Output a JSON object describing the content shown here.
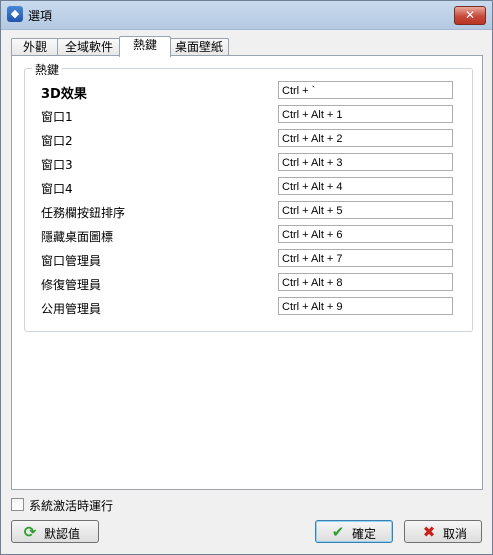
{
  "window": {
    "title": "選項",
    "close_glyph": "✕",
    "app_icon_glyph": "◆"
  },
  "tabs": [
    {
      "label": "外觀",
      "active": false
    },
    {
      "label": "全域軟件",
      "active": false
    },
    {
      "label": "熱鍵",
      "active": true
    },
    {
      "label": "桌面壁紙",
      "active": false
    }
  ],
  "hotkeys": {
    "group_title": "熱鍵",
    "rows": [
      {
        "label": "3D效果",
        "value": "Ctrl + `"
      },
      {
        "label": "窗口1",
        "value": "Ctrl + Alt + 1"
      },
      {
        "label": "窗口2",
        "value": "Ctrl + Alt + 2"
      },
      {
        "label": "窗口3",
        "value": "Ctrl + Alt + 3"
      },
      {
        "label": "窗口4",
        "value": "Ctrl + Alt + 4"
      },
      {
        "label": "任務欄按鈕排序",
        "value": "Ctrl + Alt + 5"
      },
      {
        "label": "隱藏桌面圖標",
        "value": "Ctrl + Alt + 6"
      },
      {
        "label": "窗口管理員",
        "value": "Ctrl + Alt + 7"
      },
      {
        "label": "修復管理員",
        "value": "Ctrl + Alt + 8"
      },
      {
        "label": "公用管理員",
        "value": "Ctrl + Alt + 9"
      }
    ]
  },
  "footer": {
    "startup_label": "系統激活時運行",
    "startup_checked": false,
    "defaults_label": "默認值",
    "ok_label": "確定",
    "cancel_label": "取消"
  },
  "colors": {
    "title_bar": "#b4c9e2",
    "close_button": "#c7493a",
    "refresh_icon": "#2e9e2e",
    "ok_icon": "#2e9e2e",
    "cancel_icon": "#c8201a"
  }
}
